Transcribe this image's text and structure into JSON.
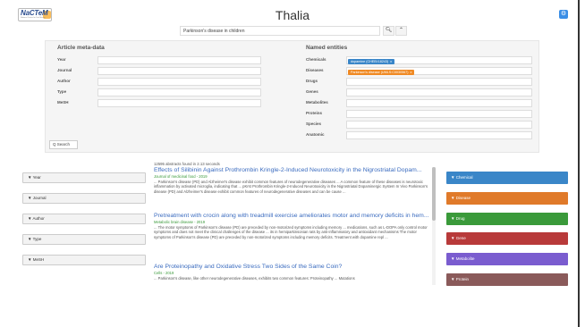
{
  "app": {
    "logo_text": "NaCTeM",
    "logo_sub": "National Centre for Text Mining",
    "title": "Thalia"
  },
  "search": {
    "value": "Parkinson's disease in children",
    "search_icon": "search-icon",
    "caret_icon": "chevron-up-icon"
  },
  "meta": {
    "heading": "Article meta-data",
    "fields": [
      "Year",
      "Journal",
      "Author",
      "Type",
      "MeSH"
    ]
  },
  "ner": {
    "heading": "Named entities",
    "fields": [
      "Chemicals",
      "Diseases",
      "Drugs",
      "Genes",
      "Metabolites",
      "Proteins",
      "Species",
      "Anatomic"
    ],
    "chemical_tag": "dopamine (CHEBI:18243)",
    "disease_tag": "Parkinson's disease (UMLS:C0030567)",
    "tag_remove": "x"
  },
  "panel_search_label": "Q  Search",
  "facets": [
    "Year",
    "Journal",
    "Author",
    "Type",
    "MeSH"
  ],
  "results": {
    "found_text": "12595 abstracts found in 2.13 seconds",
    "items": [
      {
        "title": "Effects of Silibinin Against Prothrombin Kringle-2-Induced Neurotoxicity in the Nigrostriatal Dopam...",
        "source": "Journal of medicinal food - 2019",
        "snippet": "... Parkinson's disease (PD) and Alzheimer's disease exhibit common features of neurodegenerative diseases ... A common feature of these diseases is neurotoxic inflammation by activated microglia, indicating that ... pKrst Prothrombin Kringle-2-Induced Neurotoxicity in the Nigrostriatal Dopaminergic System In Vivo Parkinson's disease (PD) and Alzheimer's disease exhibit common features of neurodegenerative diseases and can be cause ..."
      },
      {
        "title": "Pretreatment with crocin along with treadmill exercise ameliorates motor and memory deficits in hem...",
        "source": "Metabolic brain disease - 2019",
        "snippet": "... The motor symptoms of Parkinson's disease (PD) are preceded by non-motorized symptoms including memory ... medications, such as L-DOPA only control motor symptoms and does not meet the clinical challenges of the disease ... its in hemiparkinsonian rats by anti-inflammatory and antioxidant mechanisms The motor symptoms of Parkinson's disease (PD) are preceded by non-motorized symptoms including memory deficits. Treatment with dopamine repl ..."
      },
      {
        "title": "Are Proteinopathy and Oxidative Stress Two Sides of the Same Coin?",
        "source": "Cells - 2019",
        "snippet": "... Parkinson's disease, like other neurodegenerative diseases, exhibits two common features: Proteinopathy ... Mutations"
      }
    ]
  },
  "entity_facets": [
    {
      "label": "Chemical",
      "color": "#3a86c8"
    },
    {
      "label": "Disease",
      "color": "#e07a2a"
    },
    {
      "label": "Drug",
      "color": "#3a9a3a"
    },
    {
      "label": "Gene",
      "color": "#b83a3a"
    },
    {
      "label": "Metabolite",
      "color": "#7a5ccf"
    },
    {
      "label": "Protein",
      "color": "#8a5a5a"
    }
  ],
  "colors": {
    "accent": "#3a86c8",
    "link": "#3a6bbf",
    "source": "#3a9a3a",
    "chemical_tag": "#3a86c8",
    "disease_tag": "#f08a24"
  }
}
